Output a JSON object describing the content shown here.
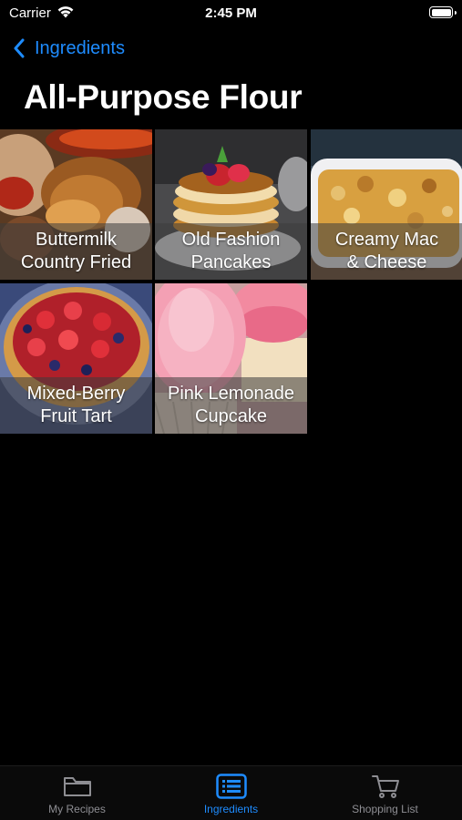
{
  "status_bar": {
    "carrier": "Carrier",
    "time": "2:45 PM"
  },
  "nav": {
    "back_label": "Ingredients"
  },
  "page": {
    "title": "All-Purpose Flour"
  },
  "recipes": [
    {
      "name": "Buttermilk\nCountry Fried"
    },
    {
      "name": "Old Fashion\nPancakes"
    },
    {
      "name": "Creamy Mac\n& Cheese"
    },
    {
      "name": "Mixed-Berry\nFruit Tart"
    },
    {
      "name": "Pink Lemonade\nCupcake"
    }
  ],
  "tab_bar": {
    "tabs": [
      {
        "label": "My Recipes",
        "icon": "folder-icon"
      },
      {
        "label": "Ingredients",
        "icon": "list-icon",
        "active": true
      },
      {
        "label": "Shopping List",
        "icon": "cart-icon"
      }
    ]
  },
  "colors": {
    "accent": "#1e8cff",
    "inactive": "#8e8e93",
    "background": "#000000"
  }
}
